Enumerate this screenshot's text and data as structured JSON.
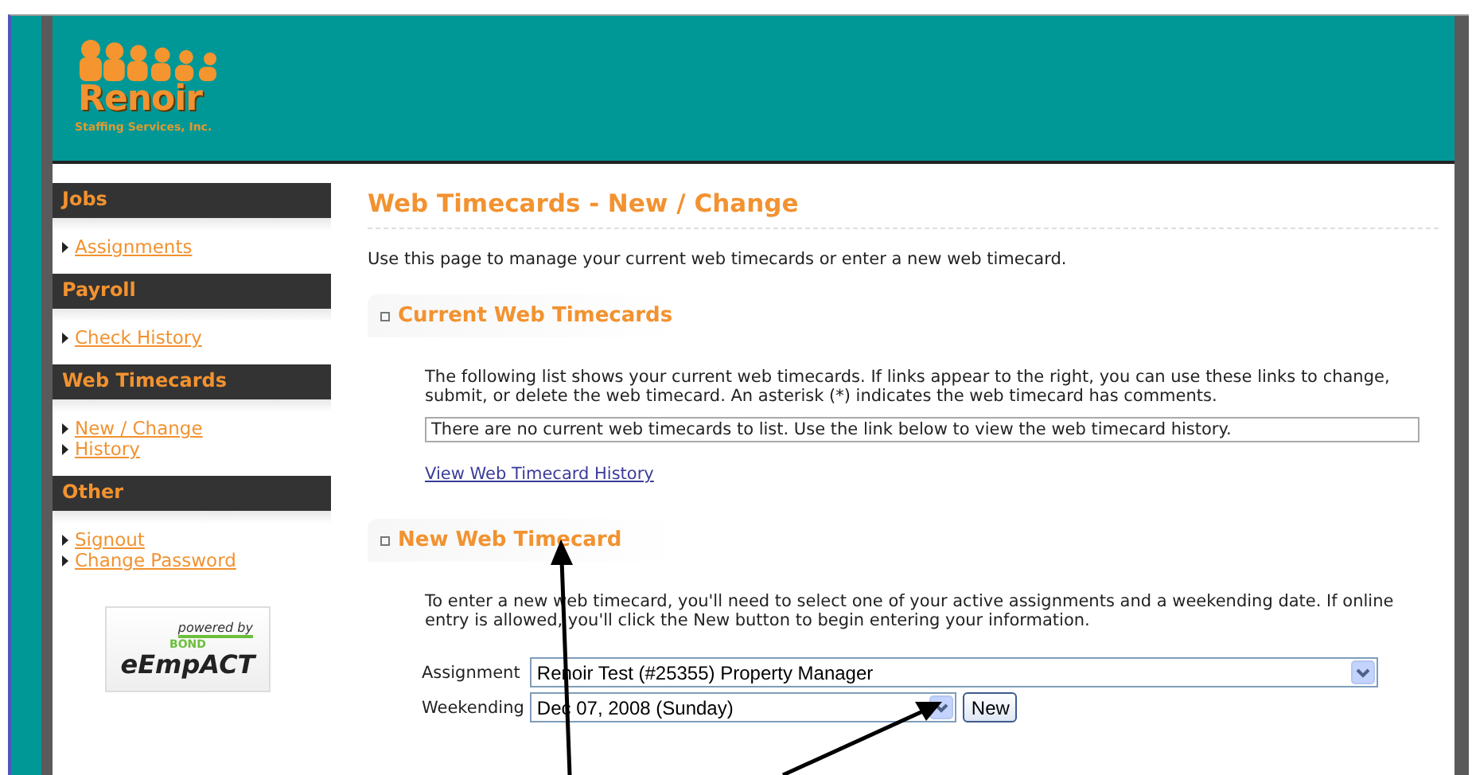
{
  "logo": {
    "name": "Renoir",
    "tagline": "Staffing Services, Inc."
  },
  "sidebar": {
    "sections": [
      {
        "title": "Jobs",
        "items": [
          {
            "label": "Assignments"
          }
        ]
      },
      {
        "title": "Payroll",
        "items": [
          {
            "label": "Check History"
          }
        ]
      },
      {
        "title": "Web Timecards",
        "items": [
          {
            "label": "New / Change"
          },
          {
            "label": "History"
          }
        ]
      },
      {
        "title": "Other",
        "items": [
          {
            "label": "Signout"
          },
          {
            "label": "Change Password"
          }
        ]
      }
    ],
    "badge": {
      "caption": "powered by",
      "brand": "BOND",
      "product": "eEmpACT"
    }
  },
  "page": {
    "title": "Web Timecards - New / Change",
    "intro": "Use this page to manage your current web timecards or enter a new web timecard."
  },
  "current": {
    "heading": "Current Web Timecards",
    "description": "The following list shows your current web timecards. If links appear to the right, you can use these links to change, submit, or delete the web timecard. An asterisk (*) indicates the web timecard has comments.",
    "empty_message": "There are no current web timecards to list. Use the link below to view the web timecard history.",
    "link": "View Web Timecard History"
  },
  "new": {
    "heading": "New Web Timecard",
    "description": "To enter a new web timecard, you'll need to select one of your active assignments and a weekending date. If online entry is allowed, you'll click the New button to begin entering your information.",
    "fields": [
      {
        "label": "Assignment",
        "value": "Renoir Test (#25355) Property Manager"
      },
      {
        "label": "Weekending",
        "value": "Dec 07, 2008 (Sunday)"
      }
    ],
    "button": "New"
  }
}
